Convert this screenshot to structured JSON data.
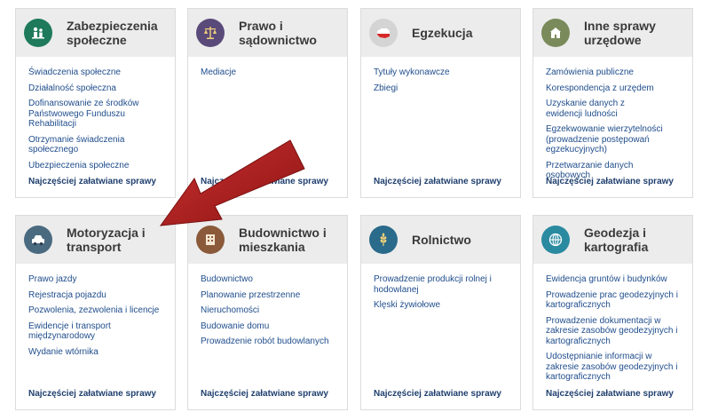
{
  "cards": [
    {
      "title": "Zabezpieczenia społeczne",
      "icon": "family-icon",
      "icon_color": "#1e7a5a",
      "links": [
        "Świadczenia społeczne",
        "Działalność społeczna",
        "Dofinansowanie ze środków Państwowego Funduszu Rehabilitacji",
        "Otrzymanie świadczenia społecznego",
        "Ubezpieczenia społeczne"
      ],
      "more": "Najczęściej załatwiane sprawy"
    },
    {
      "title": "Prawo i sądownictwo",
      "icon": "scales-icon",
      "icon_color": "#5a4a7a",
      "links": [
        "Mediacje"
      ],
      "more": "Najczęściej załatwiane sprawy"
    },
    {
      "title": "Egzekucja",
      "icon": "poland-map-icon",
      "icon_color": "#c8c8c8",
      "links": [
        "Tytuły wykonawcze",
        "Zbiegi"
      ],
      "more": "Najczęściej załatwiane sprawy"
    },
    {
      "title": "Inne sprawy urzędowe",
      "icon": "office-building-icon",
      "icon_color": "#7a8a5a",
      "links": [
        "Zamówienia publiczne",
        "Korespondencja z urzędem",
        "Uzyskanie danych z ewidencji ludności",
        "Egzekwowanie wierzytelności (prowadzenie postępowań egzekucyjnych)",
        "Przetwarzanie danych osobowych"
      ],
      "more": "Najczęściej załatwiane sprawy"
    },
    {
      "title": "Motoryzacja i transport",
      "icon": "car-icon",
      "icon_color": "#4a6a80",
      "links": [
        "Prawo jazdy",
        "Rejestracja pojazdu",
        "Pozwolenia, zezwolenia i licencje",
        "Ewidencje i transport międzynarodowy",
        "Wydanie wtórnika"
      ],
      "more": "Najczęściej załatwiane sprawy"
    },
    {
      "title": "Budownictwo i mieszkania",
      "icon": "apartment-building-icon",
      "icon_color": "#8a5a3a",
      "links": [
        "Budownictwo",
        "Planowanie przestrzenne",
        "Nieruchomości",
        "Budowanie domu",
        "Prowadzenie robót budowlanych"
      ],
      "more": "Najczęściej załatwiane sprawy"
    },
    {
      "title": "Rolnictwo",
      "icon": "wheat-icon",
      "icon_color": "#2a6a8a",
      "links": [
        "Prowadzenie produkcji rolnej i hodowlanej",
        "Klęski żywiołowe"
      ],
      "more": "Najczęściej załatwiane sprawy"
    },
    {
      "title": "Geodezja i kartografia",
      "icon": "globe-icon",
      "icon_color": "#2a8aa0",
      "links": [
        "Ewidencja gruntów i budynków",
        "Prowadzenie prac geodezyjnych i kartograficznych",
        "Prowadzenie dokumentacji w zakresie zasobów geodezyjnych i kartograficznych",
        "Udostępnianie informacji w zakresie zasobów geodezyjnych i kartograficznych"
      ],
      "more": "Najczęściej załatwiane sprawy"
    }
  ],
  "annotation": {
    "arrow_color": "#b82222"
  }
}
